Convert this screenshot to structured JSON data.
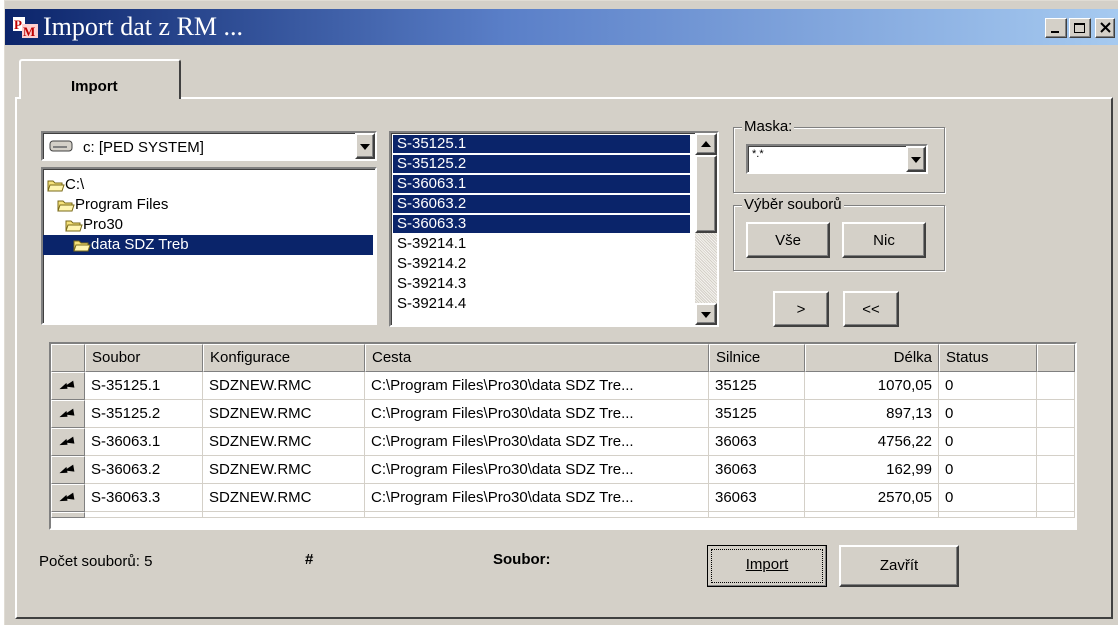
{
  "window": {
    "title": "Import dat z RM ...",
    "tab": "Import"
  },
  "drive": {
    "label": "c: [PED SYSTEM]"
  },
  "directories": [
    {
      "name": "C:\\",
      "selected": false
    },
    {
      "name": "Program Files",
      "selected": false
    },
    {
      "name": "Pro30",
      "selected": false
    },
    {
      "name": "data SDZ Treb",
      "selected": true
    }
  ],
  "files": [
    {
      "name": "S-35125.1",
      "selected": true
    },
    {
      "name": "S-35125.2",
      "selected": true
    },
    {
      "name": "S-36063.1",
      "selected": true
    },
    {
      "name": "S-36063.2",
      "selected": true
    },
    {
      "name": "S-36063.3",
      "selected": true
    },
    {
      "name": "S-39214.1",
      "selected": false
    },
    {
      "name": "S-39214.2",
      "selected": false
    },
    {
      "name": "S-39214.3",
      "selected": false
    },
    {
      "name": "S-39214.4",
      "selected": false
    }
  ],
  "mask": {
    "label": "Maska:",
    "value": "*.*"
  },
  "selection": {
    "label": "Výběr souborů",
    "all_button": "Vše",
    "none_button": "Nic"
  },
  "transfer": {
    "add_button": ">",
    "remove_all_button": "<<"
  },
  "grid": {
    "headers": [
      "Soubor",
      "Konfigurace",
      "Cesta",
      "Silnice",
      "Délka",
      "Status"
    ],
    "rows": [
      [
        "S-35125.1",
        "SDZNEW.RMC",
        "C:\\Program Files\\Pro30\\data SDZ Tre...",
        "35125",
        "1070,05",
        "0"
      ],
      [
        "S-35125.2",
        "SDZNEW.RMC",
        "C:\\Program Files\\Pro30\\data SDZ Tre...",
        "35125",
        "897,13",
        "0"
      ],
      [
        "S-36063.1",
        "SDZNEW.RMC",
        "C:\\Program Files\\Pro30\\data SDZ Tre...",
        "36063",
        "4756,22",
        "0"
      ],
      [
        "S-36063.2",
        "SDZNEW.RMC",
        "C:\\Program Files\\Pro30\\data SDZ Tre...",
        "36063",
        "162,99",
        "0"
      ],
      [
        "S-36063.3",
        "SDZNEW.RMC",
        "C:\\Program Files\\Pro30\\data SDZ Tre...",
        "36063",
        "2570,05",
        "0"
      ]
    ]
  },
  "status": {
    "file_count": "Počet souborů: 5",
    "hash": "#",
    "file_label": "Soubor:"
  },
  "buttons": {
    "import": "Import",
    "close": "Zavřít"
  },
  "colors": {
    "selection": "#0a246a",
    "face": "#d4d0c8"
  }
}
